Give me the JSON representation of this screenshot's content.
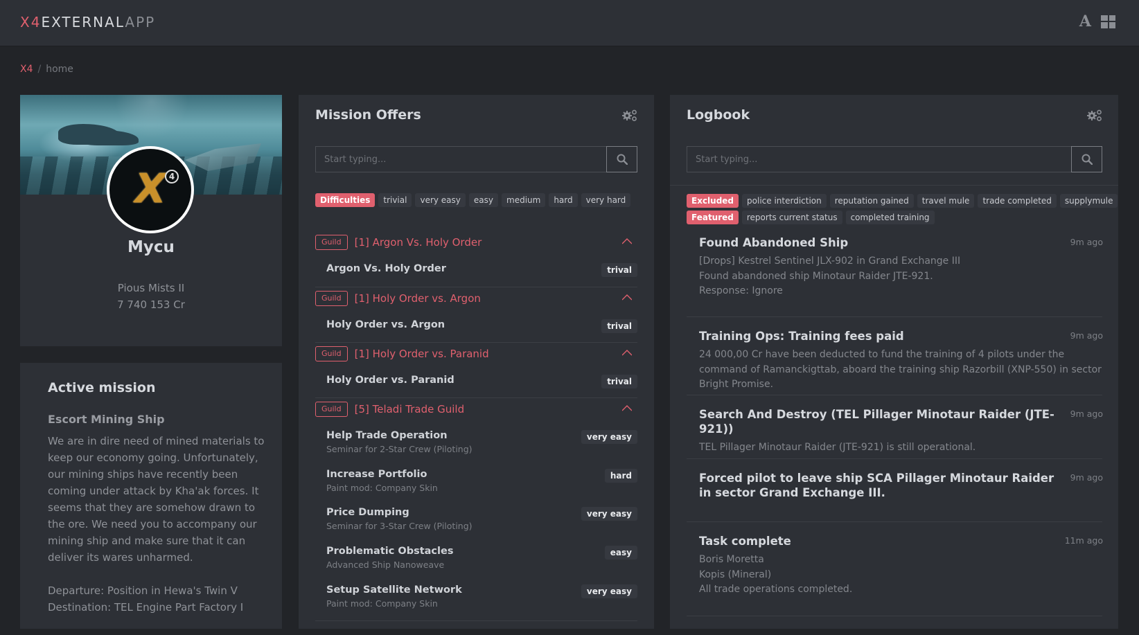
{
  "header": {
    "brand_x4": "X4",
    "brand_external": "EXTERNAL",
    "brand_app": "APP",
    "font_icon_glyph": "A",
    "icons": [
      "font-icon",
      "grid-layout-icon"
    ]
  },
  "breadcrumb": {
    "root": "X4",
    "separator": "/",
    "current": "home"
  },
  "profile": {
    "name": "Mycu",
    "location": "Pious Mists II",
    "credits": "7 740 153 Cr",
    "avatar_logo": "X",
    "avatar_superscript": "4"
  },
  "active_mission": {
    "heading": "Active mission",
    "title": "Escort Mining Ship",
    "description": "We are in dire need of mined materials to keep our economy going. Unfortunately, our mining ships have recently been coming under attack by Kha'ak forces. It seems that they are somehow drawn to the ore. We need you to accompany our mining ship and make sure that it can deliver its wares unharmed.",
    "departure": "Departure: Position in Hewa's Twin V",
    "destination": "Destination: TEL Engine Part Factory I"
  },
  "mission_offers": {
    "title": "Mission Offers",
    "search_placeholder": "Start typing...",
    "filter_label": "Difficulties",
    "filters": [
      "trivial",
      "very easy",
      "easy",
      "medium",
      "hard",
      "very hard"
    ],
    "groups": [
      {
        "badge": "Guild",
        "name": "[1] Argon Vs. Holy Order",
        "missions": [
          {
            "name": "Argon Vs. Holy Order",
            "reward": "",
            "difficulty": "trival"
          }
        ]
      },
      {
        "badge": "Guild",
        "name": "[1] Holy Order vs. Argon",
        "missions": [
          {
            "name": "Holy Order vs. Argon",
            "reward": "",
            "difficulty": "trival"
          }
        ]
      },
      {
        "badge": "Guild",
        "name": "[1] Holy Order vs. Paranid",
        "missions": [
          {
            "name": "Holy Order vs. Paranid",
            "reward": "",
            "difficulty": "trival"
          }
        ]
      },
      {
        "badge": "Guild",
        "name": "[5] Teladi Trade Guild",
        "missions": [
          {
            "name": "Help Trade Operation",
            "reward": "Seminar for 2-Star Crew (Piloting)",
            "difficulty": "very easy"
          },
          {
            "name": "Increase Portfolio",
            "reward": "Paint mod: Company Skin",
            "difficulty": "hard"
          },
          {
            "name": "Price Dumping",
            "reward": "Seminar for 3-Star Crew (Piloting)",
            "difficulty": "very easy"
          },
          {
            "name": "Problematic Obstacles",
            "reward": "Advanced Ship Nanoweave",
            "difficulty": "easy"
          },
          {
            "name": "Setup Satellite Network",
            "reward": "Paint mod: Company Skin",
            "difficulty": "very easy"
          }
        ]
      }
    ]
  },
  "logbook": {
    "title": "Logbook",
    "search_placeholder": "Start typing...",
    "excluded_label": "Excluded",
    "excluded": [
      "police interdiction",
      "reputation gained",
      "travel mule",
      "trade completed",
      "supplymule"
    ],
    "featured_label": "Featured",
    "featured": [
      "reports current status",
      "completed training"
    ],
    "entries": [
      {
        "title": "Found Abandoned Ship",
        "time": "9m ago",
        "lines": [
          "[Drops] Kestrel Sentinel JLX-902 in Grand Exchange III",
          "Found abandoned ship Minotaur Raider JTE-921.",
          "Response: Ignore"
        ]
      },
      {
        "title": "Training Ops: Training fees paid",
        "time": "9m ago",
        "lines": [
          "24 000,00 Cr have been deducted to fund the training of 4 pilots under the command of Ramanckigttab, aboard the training ship Razorbill (XNP-550) in sector Bright Promise."
        ]
      },
      {
        "title": "Search And Destroy (TEL Pillager Minotaur Raider (JTE-921))",
        "time": "9m ago",
        "lines": [
          "TEL Pillager Minotaur Raider (JTE-921) is still operational."
        ]
      },
      {
        "title": "Forced pilot to leave ship SCA Pillager Minotaur Raider in sector Grand Exchange III.",
        "time": "9m ago",
        "lines": []
      },
      {
        "title": "Task complete",
        "time": "11m ago",
        "lines": [
          "Boris Moretta",
          "Kopis (Mineral)",
          "All trade operations completed."
        ]
      }
    ]
  },
  "colors": {
    "accent": "#e0606e",
    "panel": "#2d3036",
    "background": "#222428"
  }
}
